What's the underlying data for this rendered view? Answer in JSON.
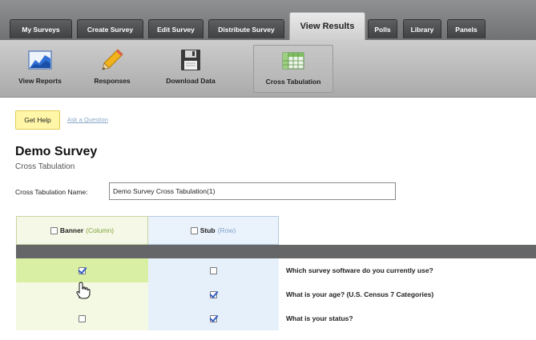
{
  "tabs": [
    {
      "label": "My Surveys"
    },
    {
      "label": "Create Survey"
    },
    {
      "label": "Edit Survey"
    },
    {
      "label": "Distribute Survey"
    },
    {
      "label": "View Results",
      "active": true
    },
    {
      "label": "Polls"
    },
    {
      "label": "Library"
    },
    {
      "label": "Panels"
    }
  ],
  "toolbar": {
    "view_reports": "View Reports",
    "responses": "Responses",
    "download_data": "Download Data",
    "cross_tabulation": "Cross Tabulation"
  },
  "help": {
    "get_help": "Get Help",
    "ask_question": "Ask a Question"
  },
  "page": {
    "title": "Demo Survey",
    "subtitle": "Cross Tabulation"
  },
  "form": {
    "name_label": "Cross Tabulation Name:",
    "name_value": "Demo Survey Cross Tabulation(1)"
  },
  "grid": {
    "banner_label": "Banner",
    "banner_hint": "(Column)",
    "stub_label": "Stub",
    "stub_hint": "(Row)",
    "rows": [
      {
        "question": "Which survey software do you currently use?",
        "banner": true,
        "stub": false
      },
      {
        "question": "What is your age? (U.S. Census 7 Categories)",
        "banner": false,
        "stub": true
      },
      {
        "question": "What is your status?",
        "banner": false,
        "stub": true
      }
    ]
  },
  "colors": {
    "tabbar": "#808284",
    "banner_highlight": "#d9efa4",
    "stub_fill": "#e6f0fb",
    "help_fill": "#fff6a8"
  }
}
